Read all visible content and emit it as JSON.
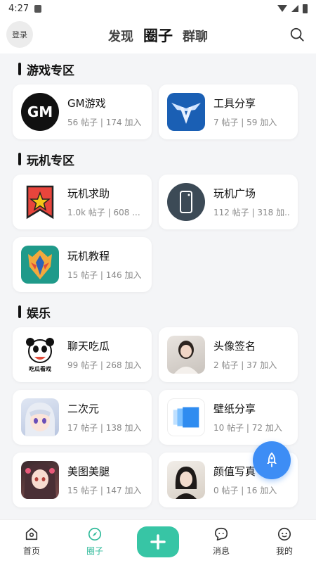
{
  "status_bar": {
    "time": "4:27"
  },
  "header": {
    "login_label": "登录",
    "tabs": [
      {
        "label": "发现"
      },
      {
        "label": "圈子"
      },
      {
        "label": "群聊"
      }
    ]
  },
  "sections": [
    {
      "title": "游戏专区",
      "items": [
        {
          "name": "GM游戏",
          "stats": "56 帖子 | 174 加入"
        },
        {
          "name": "工具分享",
          "stats": "7 帖子 | 59 加入"
        }
      ]
    },
    {
      "title": "玩机专区",
      "items": [
        {
          "name": "玩机求助",
          "stats": "1.0k 帖子 | 608 ..."
        },
        {
          "name": "玩机广场",
          "stats": "112 帖子 | 318 加..."
        },
        {
          "name": "玩机教程",
          "stats": "15 帖子 | 146 加入"
        }
      ]
    },
    {
      "title": "娱乐",
      "items": [
        {
          "name": "聊天吃瓜",
          "stats": "99 帖子 | 268 加入"
        },
        {
          "name": "头像签名",
          "stats": "2 帖子 | 37 加入"
        },
        {
          "name": "二次元",
          "stats": "17 帖子 | 138 加入"
        },
        {
          "name": "壁纸分享",
          "stats": "10 帖子 | 72 加入"
        },
        {
          "name": "美图美腿",
          "stats": "15 帖子 | 147 加入"
        },
        {
          "name": "颜值写真",
          "stats": "0 帖子 | 16 加入"
        }
      ]
    }
  ],
  "avatar_texts": {
    "gm": "GM",
    "meme": "吃瓜看戏"
  },
  "bottom_nav": {
    "home": "首页",
    "circle": "圈子",
    "messages": "消息",
    "mine": "我的"
  },
  "colors": {
    "accent": "#37c5a5",
    "fab": "#3d8df5"
  }
}
